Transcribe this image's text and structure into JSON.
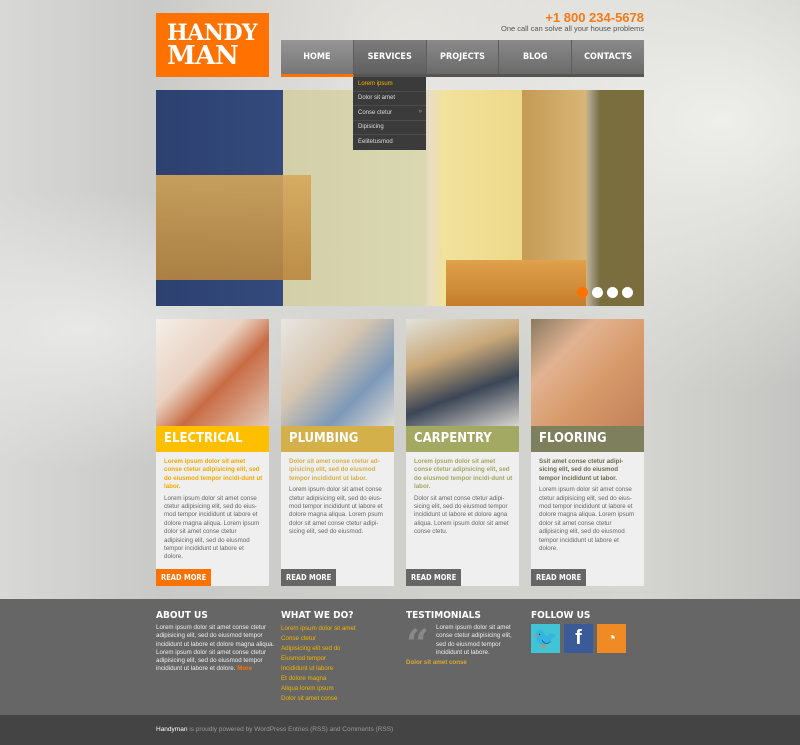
{
  "header": {
    "logo_line1": "HANDY",
    "logo_line2": "MAN",
    "phone": "+1 800 234-5678",
    "tagline": "One call can solve all your house problems"
  },
  "nav": {
    "items": [
      {
        "label": "HOME"
      },
      {
        "label": "SERVICES"
      },
      {
        "label": "PROJECTS"
      },
      {
        "label": "BLOG"
      },
      {
        "label": "CONTACTS"
      }
    ],
    "active": "HOME"
  },
  "dropdown": {
    "items": [
      {
        "label": "Lorem ipsum"
      },
      {
        "label": "Dolor sit amet"
      },
      {
        "label": "Conse ctetur",
        "arrow": "»"
      },
      {
        "label": "Dipisicing"
      },
      {
        "label": "Eelitetusmod"
      }
    ]
  },
  "slider": {
    "slides": 4,
    "current": 1,
    "accent": "#ff7200"
  },
  "cards": [
    {
      "title": "ELECTRICAL",
      "color": "#fdbf00",
      "lead_color": "#f2a900",
      "lead": "Lorem ipsum dolor sit amet conse ctetur adipisicing elit, sed do eiusmod tempor incidi-dunt ut labor.",
      "text": "Lorem ipsum dolor sit amet conse ctetur adipisicing elit, sed do eius-mod tempor incididunt ut labore et dolore magna aliqua. Lorem ipsum dolor sit amet conse ctetur adipisicing elit, sed do eiusmod tempor incididunt ut labore et dolore.",
      "button": "READ MORE",
      "button_color": "#ff7200"
    },
    {
      "title": "PLUMBING",
      "color": "#d4b04a",
      "lead_color": "#d4b04a",
      "lead": "Dolor sit amet conse ctetur ad-ipisicing elit, sed do eiusmod tempor incididunt ut labor.",
      "text": "Lorem ipsum dolor sit amet conse ctetur adipisicing elit, sed do eius-mod tempor incididunt ut labore et dolore magna aliqua. Lorem psum dolor sit amet conse ctetur adipi-sicing elit, sed do eiusmod.",
      "button": "READ MORE",
      "button_color": "#666666"
    },
    {
      "title": "CARPENTRY",
      "color": "#a3a862",
      "lead_color": "#a3a862",
      "lead": "Lorem ipsum dolor sit amet conse ctetur adipisicing elit, sed do eiusmod tempor incidi-dunt ut labor.",
      "text": "Dolor sit amet conse ctetur adipi-sicing elit, sed do eiusmod tempor incididunt ut labore et dolore agna aliqua. Lorem ipsum dolor sit amet conse ctetu.",
      "button": "READ MORE",
      "button_color": "#666666"
    },
    {
      "title": "FLOORING",
      "color": "#7e7f5c",
      "lead_color": "#6b6c50",
      "lead": "Ssit amet conse ctetur adipi-sicing elit, sed do eiusmod tempor incididunt ut labor.",
      "text": "Lorem ipsum dolor sit amet conse ctetur adipisicing elit, sed do eius-mod tempor incididunt ut labore et dolore magna aliqua. Lorem ipsum dolor sit amet conse ctetur adipisicing elit, sed do eiusmod tempor incididunt ut labore et dolore.",
      "button": "READ MORE",
      "button_color": "#666666"
    }
  ],
  "footer": {
    "about": {
      "title": "ABOUT US",
      "text": "Lorem ipsum dolor sit amet conse ctetur adipisicing elit, sed do eiusmod tempor incididunt ut labore et dolore magna aliqua. Lorem ipsum dolor sit amet conse ctetur adipisicing elit, sed do eiusmod tempor incididunt ut labore et dolore.",
      "more": "More"
    },
    "whatwedo": {
      "title": "WHAT WE DO?",
      "links": [
        "Lorem ipsum dolor sit amet",
        "Conse ctetur",
        "Adipisicing elit sed do",
        "Eiusmod tempor",
        "Incididunt ut labore",
        "Et dolore magna",
        "Aliqua lorem ipsum",
        "Dolor sit amet conse"
      ]
    },
    "testimonials": {
      "title": "TESTIMONIALS",
      "quote": "Lorem ipsum dolor sit amet conse ctetur adipisicing elit, sed do eiusmod tempor incididunt ut labore.",
      "author": "Dolor sit amet conse"
    },
    "follow": {
      "title": "FOLLOW US",
      "icons": [
        "twitter-icon",
        "facebook-icon",
        "rss-icon"
      ]
    }
  },
  "bottom": {
    "brand": "Handyman",
    "text": " is proudly powered by WordPress  Entries (RSS) and Comments (RSS)"
  }
}
